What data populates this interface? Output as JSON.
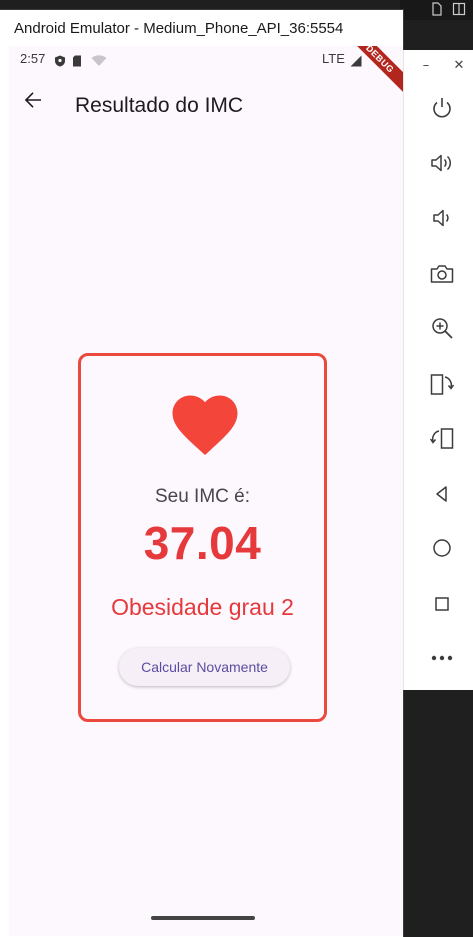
{
  "emulator": {
    "window_title": "Android Emulator - Medium_Phone_API_36:5554"
  },
  "status_bar": {
    "time": "2:57",
    "network": "LTE",
    "debug_banner": "DEBUG"
  },
  "app_bar": {
    "title": "Resultado do IMC"
  },
  "result": {
    "label": "Seu IMC é:",
    "value": "37.04",
    "classification": "Obesidade grau 2",
    "button_label": "Calcular Novamente"
  },
  "colors": {
    "accent_red": "#e5393b",
    "card_border": "#ea4a3d",
    "background": "#fdf7fe",
    "button_text": "#5a4da0"
  },
  "toolbar": {
    "items": [
      "power-icon",
      "volume-up-icon",
      "volume-down-icon",
      "camera-icon",
      "zoom-in-icon",
      "rotate-left-icon",
      "rotate-right-icon",
      "back-icon",
      "home-icon",
      "overview-icon",
      "more-icon"
    ]
  }
}
